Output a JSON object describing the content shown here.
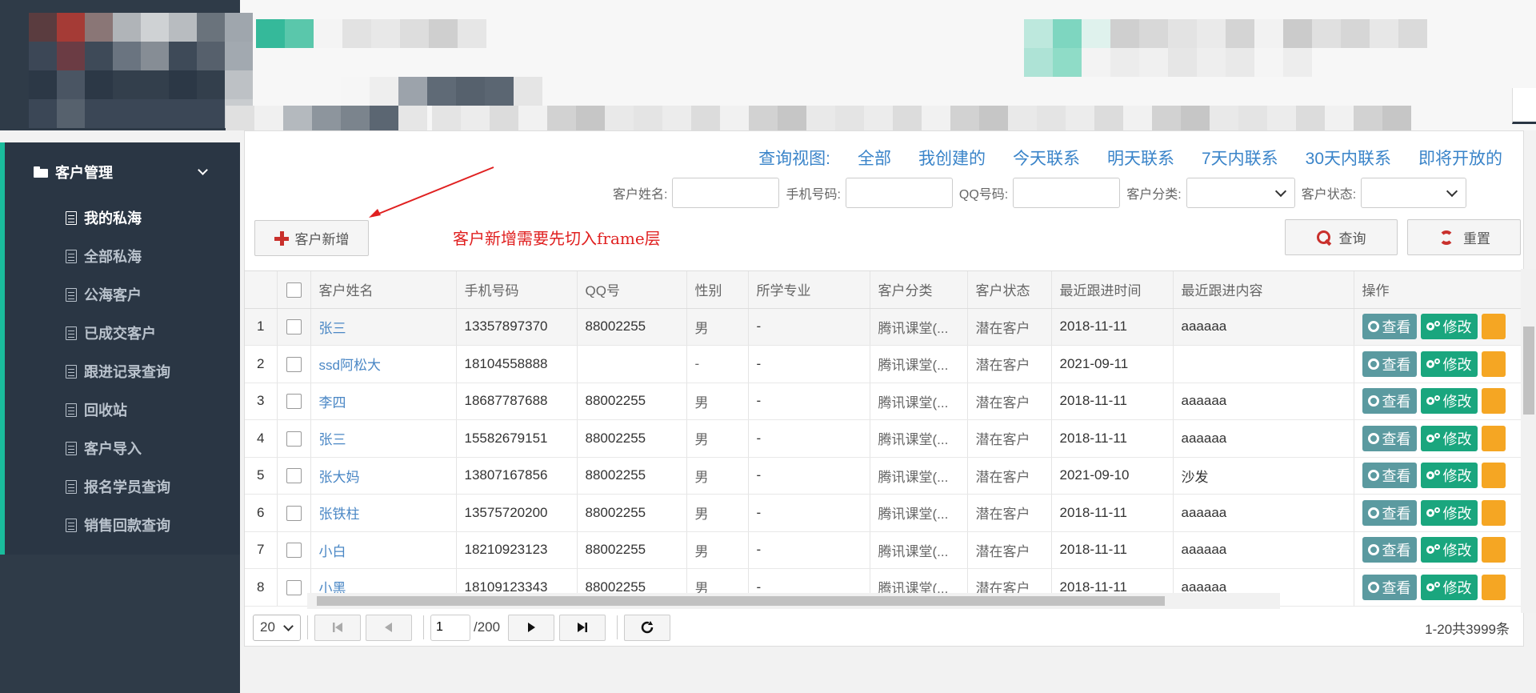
{
  "sidebar": {
    "group_title": "客户管理",
    "items": [
      {
        "label": "我的私海",
        "active": true
      },
      {
        "label": "全部私海",
        "active": false
      },
      {
        "label": "公海客户",
        "active": false
      },
      {
        "label": "已成交客户",
        "active": false
      },
      {
        "label": "跟进记录查询",
        "active": false
      },
      {
        "label": "回收站",
        "active": false
      },
      {
        "label": "客户导入",
        "active": false
      },
      {
        "label": "报名学员查询",
        "active": false
      },
      {
        "label": "销售回款查询",
        "active": false
      }
    ]
  },
  "views": {
    "label": "查询视图:",
    "links": [
      "全部",
      "我创建的",
      "今天联系",
      "明天联系",
      "7天内联系",
      "30天内联系",
      "即将开放的"
    ]
  },
  "filters": {
    "name_label": "客户姓名:",
    "phone_label": "手机号码:",
    "qq_label": "QQ号码:",
    "category_label": "客户分类:",
    "status_label": "客户状态:"
  },
  "toolbar": {
    "add_label": "客户新增",
    "search_label": "查询",
    "reset_label": "重置"
  },
  "annotation": "客户新增需要先切入frame层",
  "table": {
    "headers": [
      "客户姓名",
      "手机号码",
      "QQ号",
      "性别",
      "所学专业",
      "客户分类",
      "客户状态",
      "最近跟进时间",
      "最近跟进内容",
      "操作"
    ],
    "rows": [
      {
        "num": "1",
        "name": "张三",
        "phone": "13357897370",
        "qq": "88002255",
        "gender": "男",
        "major": "-",
        "category": "腾讯课堂(...",
        "status": "潜在客户",
        "time": "2018-11-11",
        "content": "aaaaaa"
      },
      {
        "num": "2",
        "name": "ssd阿松大",
        "phone": "18104558888",
        "qq": "",
        "gender": "-",
        "major": "-",
        "category": "腾讯课堂(...",
        "status": "潜在客户",
        "time": "2021-09-11",
        "content": ""
      },
      {
        "num": "3",
        "name": "李四",
        "phone": "18687787688",
        "qq": "88002255",
        "gender": "男",
        "major": "-",
        "category": "腾讯课堂(...",
        "status": "潜在客户",
        "time": "2018-11-11",
        "content": "aaaaaa"
      },
      {
        "num": "4",
        "name": "张三",
        "phone": "15582679151",
        "qq": "88002255",
        "gender": "男",
        "major": "-",
        "category": "腾讯课堂(...",
        "status": "潜在客户",
        "time": "2018-11-11",
        "content": "aaaaaa"
      },
      {
        "num": "5",
        "name": "张大妈",
        "phone": "13807167856",
        "qq": "88002255",
        "gender": "男",
        "major": "-",
        "category": "腾讯课堂(...",
        "status": "潜在客户",
        "time": "2021-09-10",
        "content": "沙发"
      },
      {
        "num": "6",
        "name": "张铁柱",
        "phone": "13575720200",
        "qq": "88002255",
        "gender": "男",
        "major": "-",
        "category": "腾讯课堂(...",
        "status": "潜在客户",
        "time": "2018-11-11",
        "content": "aaaaaa"
      },
      {
        "num": "7",
        "name": "小白",
        "phone": "18210923123",
        "qq": "88002255",
        "gender": "男",
        "major": "-",
        "category": "腾讯课堂(...",
        "status": "潜在客户",
        "time": "2018-11-11",
        "content": "aaaaaa"
      },
      {
        "num": "8",
        "name": "小黑",
        "phone": "18109123343",
        "qq": "88002255",
        "gender": "男",
        "major": "-",
        "category": "腾讯课堂(...",
        "status": "潜在客户",
        "time": "2018-11-11",
        "content": "aaaaaa"
      }
    ],
    "op_view": "查看",
    "op_edit": "修改"
  },
  "pager": {
    "page_size": "20",
    "current_page": "1",
    "total_pages": "/200",
    "info": "1-20共3999条"
  },
  "colors": {
    "sidebar_bg": "#2f3b48",
    "accent": "#1abc9c",
    "link": "#3a84c9",
    "annotation": "#e02020",
    "view_btn": "#5b9aa0",
    "edit_btn": "#1aa67e",
    "more_btn": "#f5a623"
  },
  "icons": [
    "folder-icon",
    "chevron-down-icon",
    "document-icon",
    "plus-icon",
    "search-icon",
    "refresh-icon",
    "gears-icon",
    "first-page-icon",
    "prev-page-icon",
    "next-page-icon",
    "last-page-icon",
    "reload-icon"
  ]
}
